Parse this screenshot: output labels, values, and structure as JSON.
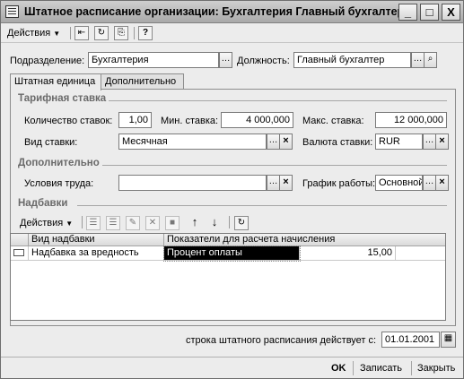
{
  "window": {
    "title": "Штатное расписание организации: Бухгалтерия Главный бухгалтер",
    "controls": {
      "minimize": "_",
      "maximize": "□",
      "close": "X"
    }
  },
  "toolbar": {
    "actions_menu": "Действия",
    "help_label": "?"
  },
  "header": {
    "department_label": "Подразделение:",
    "department_value": "Бухгалтерия",
    "position_label": "Должность:",
    "position_value": "Главный бухгалтер"
  },
  "tabs": [
    "Штатная единица",
    "Дополнительно"
  ],
  "tariff": {
    "section_title": "Тарифная ставка",
    "rates_count_label": "Количество ставок:",
    "rates_count_value": "1,00",
    "min_rate_label": "Мин. ставка:",
    "min_rate_value": "4 000,000",
    "max_rate_label": "Макс. ставка:",
    "max_rate_value": "12 000,000",
    "rate_type_label": "Вид ставки:",
    "rate_type_value": "Месячная",
    "currency_label": "Валюта ставки:",
    "currency_value": "RUR"
  },
  "additional": {
    "section_title": "Дополнительно",
    "work_conditions_label": "Условия труда:",
    "work_conditions_value": "",
    "schedule_label": "График работы:",
    "schedule_value": "Основной"
  },
  "allowances": {
    "section_title": "Надбавки",
    "actions_menu": "Действия",
    "columns": [
      "Вид надбавки",
      "Показатели для расчета начисления"
    ],
    "rows": [
      {
        "type": "Надбавка за вредность",
        "indicator": "Процент оплаты",
        "value": "15,00"
      }
    ]
  },
  "footer": {
    "effective_label": "строка штатного расписания действует с:",
    "effective_date": "01.01.2001"
  },
  "buttons": {
    "ok": "OK",
    "save": "Записать",
    "close": "Закрыть"
  }
}
